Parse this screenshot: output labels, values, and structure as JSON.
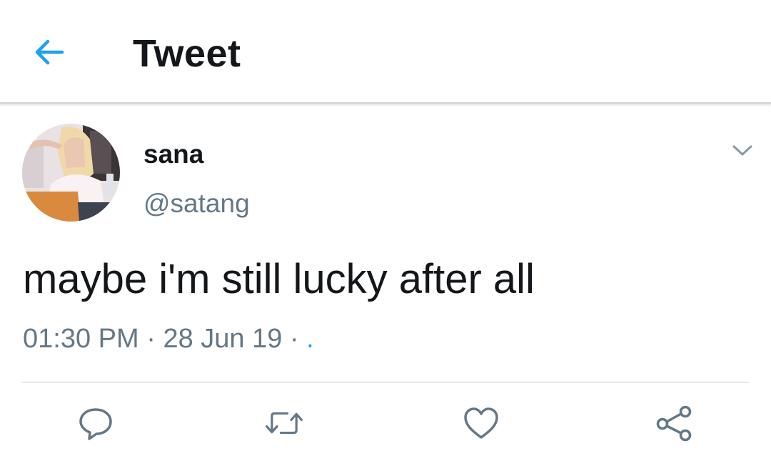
{
  "header": {
    "title": "Tweet",
    "back_icon": "back-arrow-icon",
    "accent_color": "#1da1f2"
  },
  "tweet": {
    "display_name": "sana",
    "handle": "@satang",
    "text": "maybe i'm still lucky after all",
    "time": "01:30 PM",
    "date": "28 Jun 19",
    "separator": "·",
    "source": ".",
    "menu_icon": "chevron-down-icon"
  },
  "actions": [
    {
      "name": "reply",
      "icon": "reply-icon"
    },
    {
      "name": "retweet",
      "icon": "retweet-icon"
    },
    {
      "name": "like",
      "icon": "heart-icon"
    },
    {
      "name": "share",
      "icon": "share-icon"
    }
  ],
  "colors": {
    "text_primary": "#14171a",
    "text_secondary": "#657786",
    "divider": "#e1e8ed"
  }
}
